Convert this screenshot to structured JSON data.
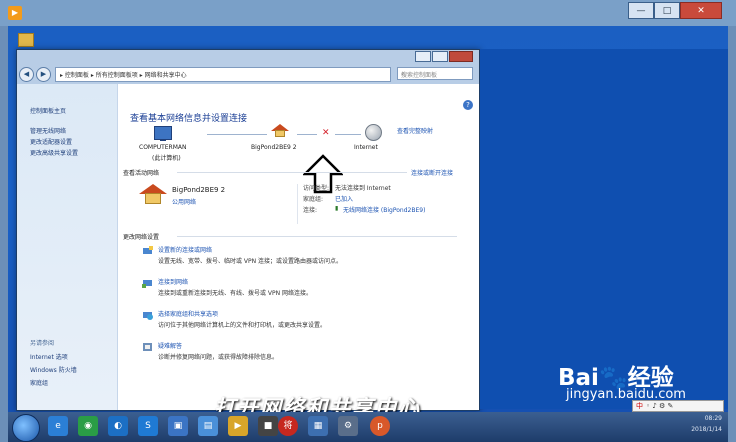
{
  "outer": {
    "caption_buttons": [
      "—",
      "□",
      "✕"
    ]
  },
  "address_bar": {
    "back": "◀",
    "forward": "▶",
    "path": "▸ 控制面板 ▸ 所有控制面板项 ▸ 网络和共享中心",
    "search_placeholder": "搜索控制面板"
  },
  "sidebar": {
    "home": "控制面板主页",
    "links": [
      "管理无线网络",
      "更改适配器设置",
      "更改高级共享设置"
    ],
    "see_also_title": "另请参阅",
    "see_also": [
      "Internet 选项",
      "Windows 防火墙",
      "家庭组"
    ]
  },
  "main": {
    "heading": "查看基本网络信息并设置连接",
    "view_full_map": "查看完整映射",
    "map": {
      "computer_name": "COMPUTERMAN",
      "computer_sub": "(此计算机)",
      "network_name": "BigPond2BE9 2",
      "internet": "Internet"
    },
    "active_networks_title": "查看活动网络",
    "connect_disconnect": "连接或断开连接",
    "active_network": {
      "name": "BigPond2BE9 2",
      "type": "公用网络",
      "access_type_label": "访问类型:",
      "access_type_value": "无法连接到 Internet",
      "homegroup_label": "家庭组:",
      "homegroup_value": "已加入",
      "connections_label": "连接:",
      "connections_value": "无线网络连接 (BigPond2BE9)"
    },
    "change_settings_title": "更改网络设置",
    "tasks": [
      {
        "title": "设置新的连接或网络",
        "desc": "设置无线、宽带、拨号、临时或 VPN 连接；或设置路由器或访问点。"
      },
      {
        "title": "连接到网络",
        "desc": "连接到或重新连接到无线、有线、拨号或 VPN 网络连接。"
      },
      {
        "title": "选择家庭组和共享选项",
        "desc": "访问位于其他网络计算机上的文件和打印机，或更改共享设置。"
      },
      {
        "title": "疑难解答",
        "desc": "诊断并修复网络问题，或获得故障排除信息。"
      }
    ]
  },
  "overlay": {
    "caption": "打开网络和共享中心",
    "baidu_logo_left": "Bai",
    "baidu_logo_right": "经验",
    "baidu_url": "jingyan.baidu.com"
  },
  "taskbar": {
    "time": "08:29",
    "date": "2018/1/14",
    "tray_badge": "中"
  },
  "colors": {
    "link": "#1d54b2",
    "heading": "#1b3f95",
    "desktop": "#1a62c9",
    "error_cross": "#d4202a"
  }
}
